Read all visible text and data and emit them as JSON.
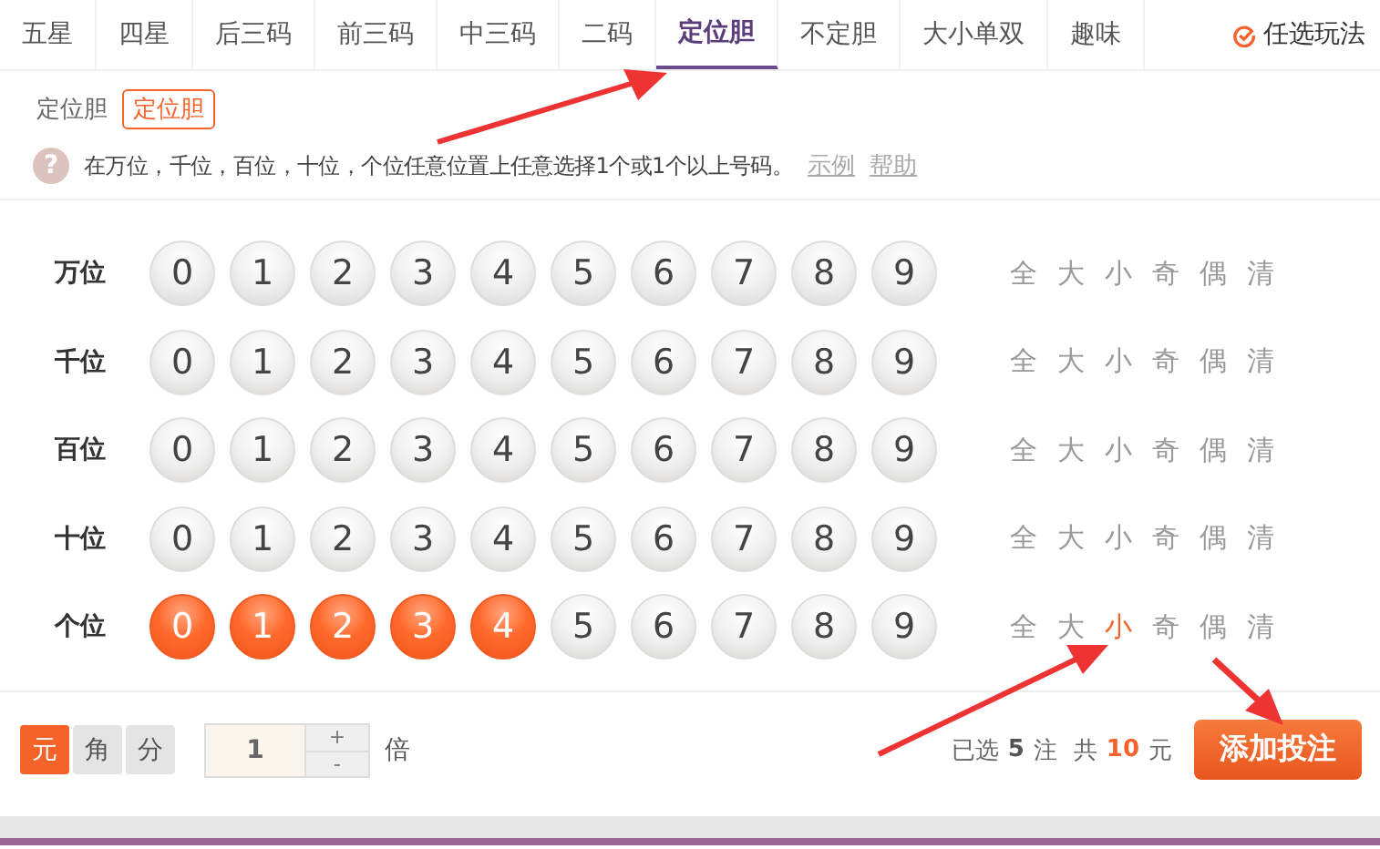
{
  "tabs": [
    {
      "label": "五星",
      "selected": false
    },
    {
      "label": "四星",
      "selected": false
    },
    {
      "label": "后三码",
      "selected": false
    },
    {
      "label": "前三码",
      "selected": false
    },
    {
      "label": "中三码",
      "selected": false
    },
    {
      "label": "二码",
      "selected": false
    },
    {
      "label": "定位胆",
      "selected": true
    },
    {
      "label": "不定胆",
      "selected": false
    },
    {
      "label": "大小单双",
      "selected": false
    },
    {
      "label": "趣味",
      "selected": false
    }
  ],
  "custom_play": {
    "label": "任选玩法"
  },
  "sub_group": {
    "label": "定位胆",
    "options": [
      {
        "label": "定位胆",
        "selected": true
      }
    ]
  },
  "hint": {
    "icon": "?",
    "text": "在万位，千位，百位，十位，个位任意位置上任意选择1个或1个以上号码。",
    "links": [
      "示例",
      "帮助"
    ]
  },
  "rows": [
    {
      "label": "万位",
      "balls": [
        {
          "n": "0",
          "selected": false
        },
        {
          "n": "1",
          "selected": false
        },
        {
          "n": "2",
          "selected": false
        },
        {
          "n": "3",
          "selected": false
        },
        {
          "n": "4",
          "selected": false
        },
        {
          "n": "5",
          "selected": false
        },
        {
          "n": "6",
          "selected": false
        },
        {
          "n": "7",
          "selected": false
        },
        {
          "n": "8",
          "selected": false
        },
        {
          "n": "9",
          "selected": false
        }
      ],
      "filters": [
        {
          "label": "全",
          "selected": false
        },
        {
          "label": "大",
          "selected": false
        },
        {
          "label": "小",
          "selected": false
        },
        {
          "label": "奇",
          "selected": false
        },
        {
          "label": "偶",
          "selected": false
        },
        {
          "label": "清",
          "selected": false
        }
      ]
    },
    {
      "label": "千位",
      "balls": [
        {
          "n": "0",
          "selected": false
        },
        {
          "n": "1",
          "selected": false
        },
        {
          "n": "2",
          "selected": false
        },
        {
          "n": "3",
          "selected": false
        },
        {
          "n": "4",
          "selected": false
        },
        {
          "n": "5",
          "selected": false
        },
        {
          "n": "6",
          "selected": false
        },
        {
          "n": "7",
          "selected": false
        },
        {
          "n": "8",
          "selected": false
        },
        {
          "n": "9",
          "selected": false
        }
      ],
      "filters": [
        {
          "label": "全",
          "selected": false
        },
        {
          "label": "大",
          "selected": false
        },
        {
          "label": "小",
          "selected": false
        },
        {
          "label": "奇",
          "selected": false
        },
        {
          "label": "偶",
          "selected": false
        },
        {
          "label": "清",
          "selected": false
        }
      ]
    },
    {
      "label": "百位",
      "balls": [
        {
          "n": "0",
          "selected": false
        },
        {
          "n": "1",
          "selected": false
        },
        {
          "n": "2",
          "selected": false
        },
        {
          "n": "3",
          "selected": false
        },
        {
          "n": "4",
          "selected": false
        },
        {
          "n": "5",
          "selected": false
        },
        {
          "n": "6",
          "selected": false
        },
        {
          "n": "7",
          "selected": false
        },
        {
          "n": "8",
          "selected": false
        },
        {
          "n": "9",
          "selected": false
        }
      ],
      "filters": [
        {
          "label": "全",
          "selected": false
        },
        {
          "label": "大",
          "selected": false
        },
        {
          "label": "小",
          "selected": false
        },
        {
          "label": "奇",
          "selected": false
        },
        {
          "label": "偶",
          "selected": false
        },
        {
          "label": "清",
          "selected": false
        }
      ]
    },
    {
      "label": "十位",
      "balls": [
        {
          "n": "0",
          "selected": false
        },
        {
          "n": "1",
          "selected": false
        },
        {
          "n": "2",
          "selected": false
        },
        {
          "n": "3",
          "selected": false
        },
        {
          "n": "4",
          "selected": false
        },
        {
          "n": "5",
          "selected": false
        },
        {
          "n": "6",
          "selected": false
        },
        {
          "n": "7",
          "selected": false
        },
        {
          "n": "8",
          "selected": false
        },
        {
          "n": "9",
          "selected": false
        }
      ],
      "filters": [
        {
          "label": "全",
          "selected": false
        },
        {
          "label": "大",
          "selected": false
        },
        {
          "label": "小",
          "selected": false
        },
        {
          "label": "奇",
          "selected": false
        },
        {
          "label": "偶",
          "selected": false
        },
        {
          "label": "清",
          "selected": false
        }
      ]
    },
    {
      "label": "个位",
      "balls": [
        {
          "n": "0",
          "selected": true
        },
        {
          "n": "1",
          "selected": true
        },
        {
          "n": "2",
          "selected": true
        },
        {
          "n": "3",
          "selected": true
        },
        {
          "n": "4",
          "selected": true
        },
        {
          "n": "5",
          "selected": false
        },
        {
          "n": "6",
          "selected": false
        },
        {
          "n": "7",
          "selected": false
        },
        {
          "n": "8",
          "selected": false
        },
        {
          "n": "9",
          "selected": false
        }
      ],
      "filters": [
        {
          "label": "全",
          "selected": false
        },
        {
          "label": "大",
          "selected": false
        },
        {
          "label": "小",
          "selected": true
        },
        {
          "label": "奇",
          "selected": false
        },
        {
          "label": "偶",
          "selected": false
        },
        {
          "label": "清",
          "selected": false
        }
      ]
    }
  ],
  "units": [
    {
      "label": "元",
      "selected": true
    },
    {
      "label": "角",
      "selected": false
    },
    {
      "label": "分",
      "selected": false
    }
  ],
  "multiplier": {
    "value": "1",
    "plus": "+",
    "minus": "-",
    "unit": "倍"
  },
  "summary": {
    "prefix": "已选",
    "count": "5",
    "count_unit": "注",
    "total_prefix": "共",
    "amount": "10",
    "currency": "元"
  },
  "add_button": {
    "label": "添加投注"
  }
}
